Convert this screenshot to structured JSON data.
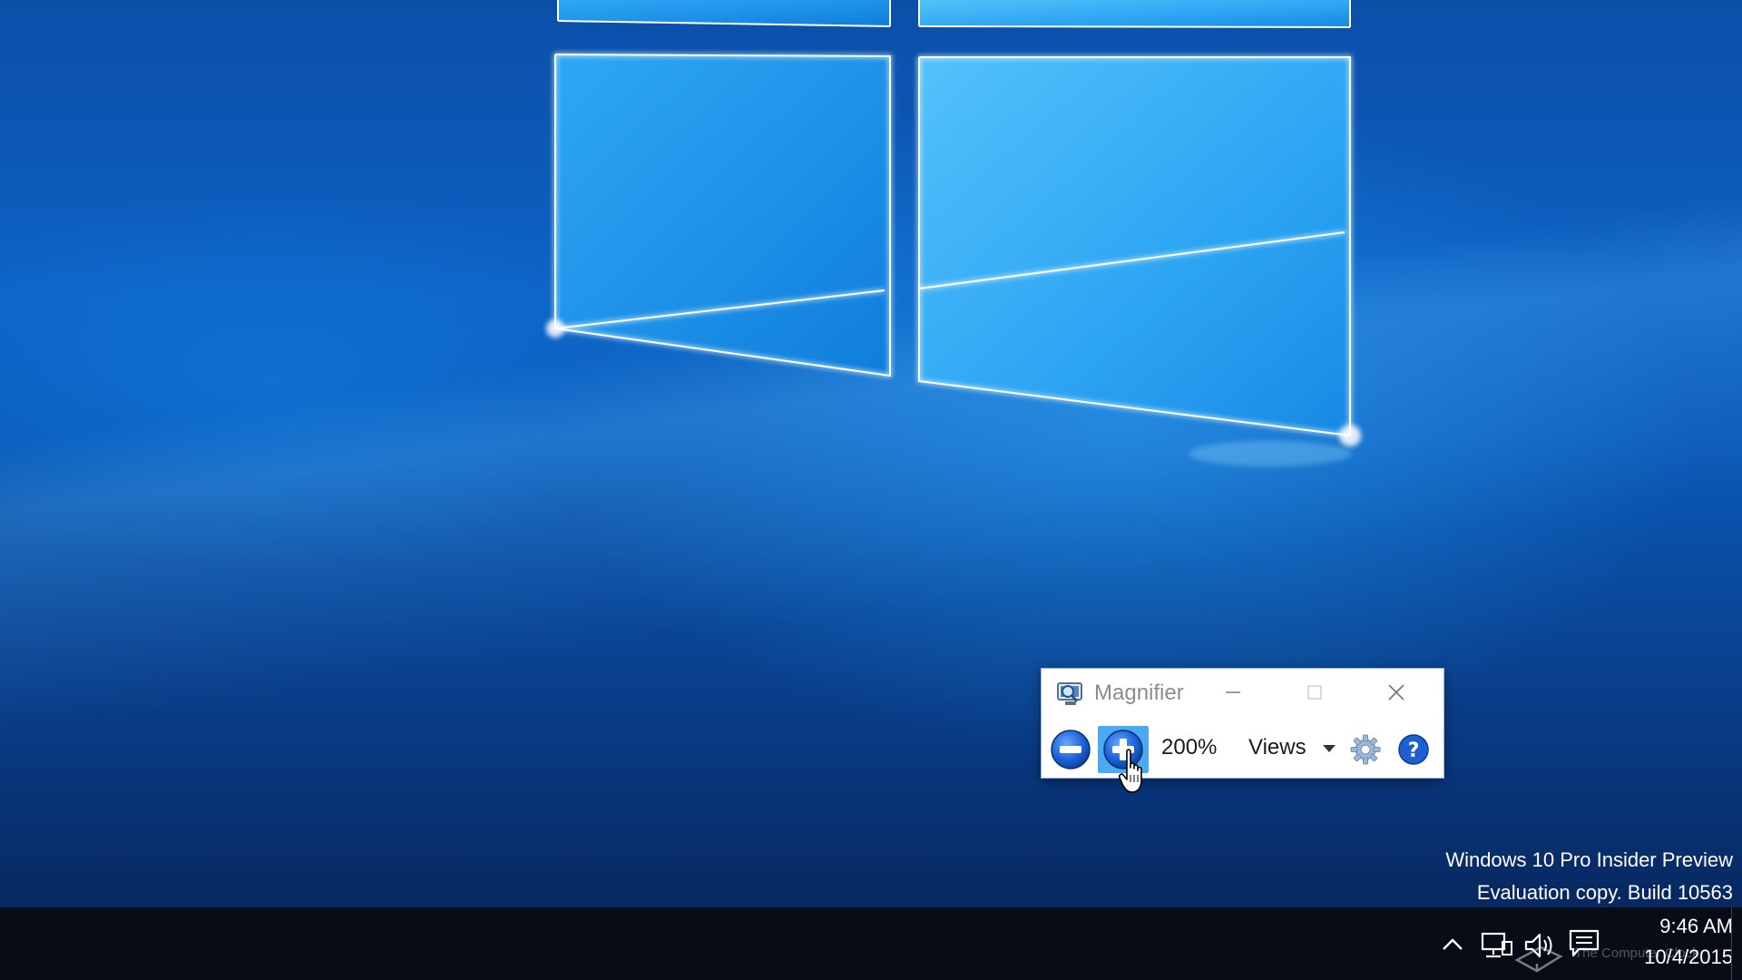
{
  "desktop": {
    "watermark": {
      "line1": "Windows 10 Pro Insider Preview",
      "line2": "Evaluation copy. Build 10563"
    },
    "credit": "The Computer Clock"
  },
  "magnifier": {
    "title": "Magnifier",
    "app_icon": "magnifier-app-icon",
    "zoom_level": "200%",
    "views_label": "Views",
    "buttons": {
      "minimize": "minimize-icon",
      "maximize": "maximize-icon",
      "close": "close-icon",
      "zoom_out": "zoom-out-icon",
      "zoom_in": "zoom-in-icon",
      "options": "gear-icon",
      "help": "help-icon"
    },
    "colors": {
      "zoom_in_highlight": "#4aa9f0",
      "button_blue": "#1d63d8"
    }
  },
  "taskbar": {
    "tray_icons": [
      "chevron-up-icon",
      "network-icon",
      "volume-icon",
      "action-center-icon"
    ],
    "clock": {
      "time": "9:46 AM",
      "date": "10/4/2015"
    },
    "background": "#070c16"
  }
}
